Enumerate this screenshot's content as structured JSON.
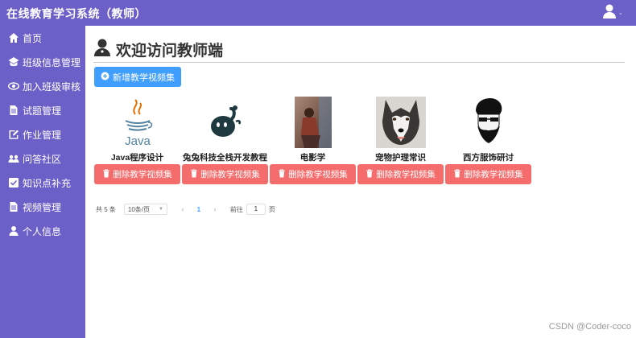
{
  "header": {
    "title": "在线教育学习系统（教师）",
    "user_icon": "user-icon",
    "caret": "⌄"
  },
  "sidebar": {
    "items": [
      {
        "label": "首页",
        "icon": "home-icon"
      },
      {
        "label": "班级信息管理",
        "icon": "class-icon"
      },
      {
        "label": "加入班级审核",
        "icon": "eye-icon"
      },
      {
        "label": "试题管理",
        "icon": "document-icon"
      },
      {
        "label": "作业管理",
        "icon": "edit-icon"
      },
      {
        "label": "问答社区",
        "icon": "community-icon"
      },
      {
        "label": "知识点补充",
        "icon": "check-icon"
      },
      {
        "label": "视频管理",
        "icon": "document-icon"
      },
      {
        "label": "个人信息",
        "icon": "user-icon"
      }
    ]
  },
  "main": {
    "welcome": "欢迎访问教师端",
    "add_button": "新增教学视频集",
    "delete_label": "删除教学视频集",
    "cards": [
      {
        "name": "Java程序设计",
        "thumb": "java-logo"
      },
      {
        "name": "兔兔科技全栈开发教程",
        "thumb": "bunny-logo"
      },
      {
        "name": "电影学",
        "thumb": "film-photo"
      },
      {
        "name": "宠物护理常识",
        "thumb": "husky-photo"
      },
      {
        "name": "西方服饰研讨",
        "thumb": "bearded-man-illustration"
      }
    ]
  },
  "pagination": {
    "total": "共 5 条",
    "page_size": "10条/页",
    "prev": "‹",
    "current": "1",
    "next": "›",
    "goto_label": "前往",
    "goto_value": "1",
    "page_unit": "页"
  },
  "watermark": "CSDN @Coder-coco",
  "colors": {
    "header": "#6b5fc8",
    "primary": "#409eff",
    "danger": "#f56c6c"
  }
}
